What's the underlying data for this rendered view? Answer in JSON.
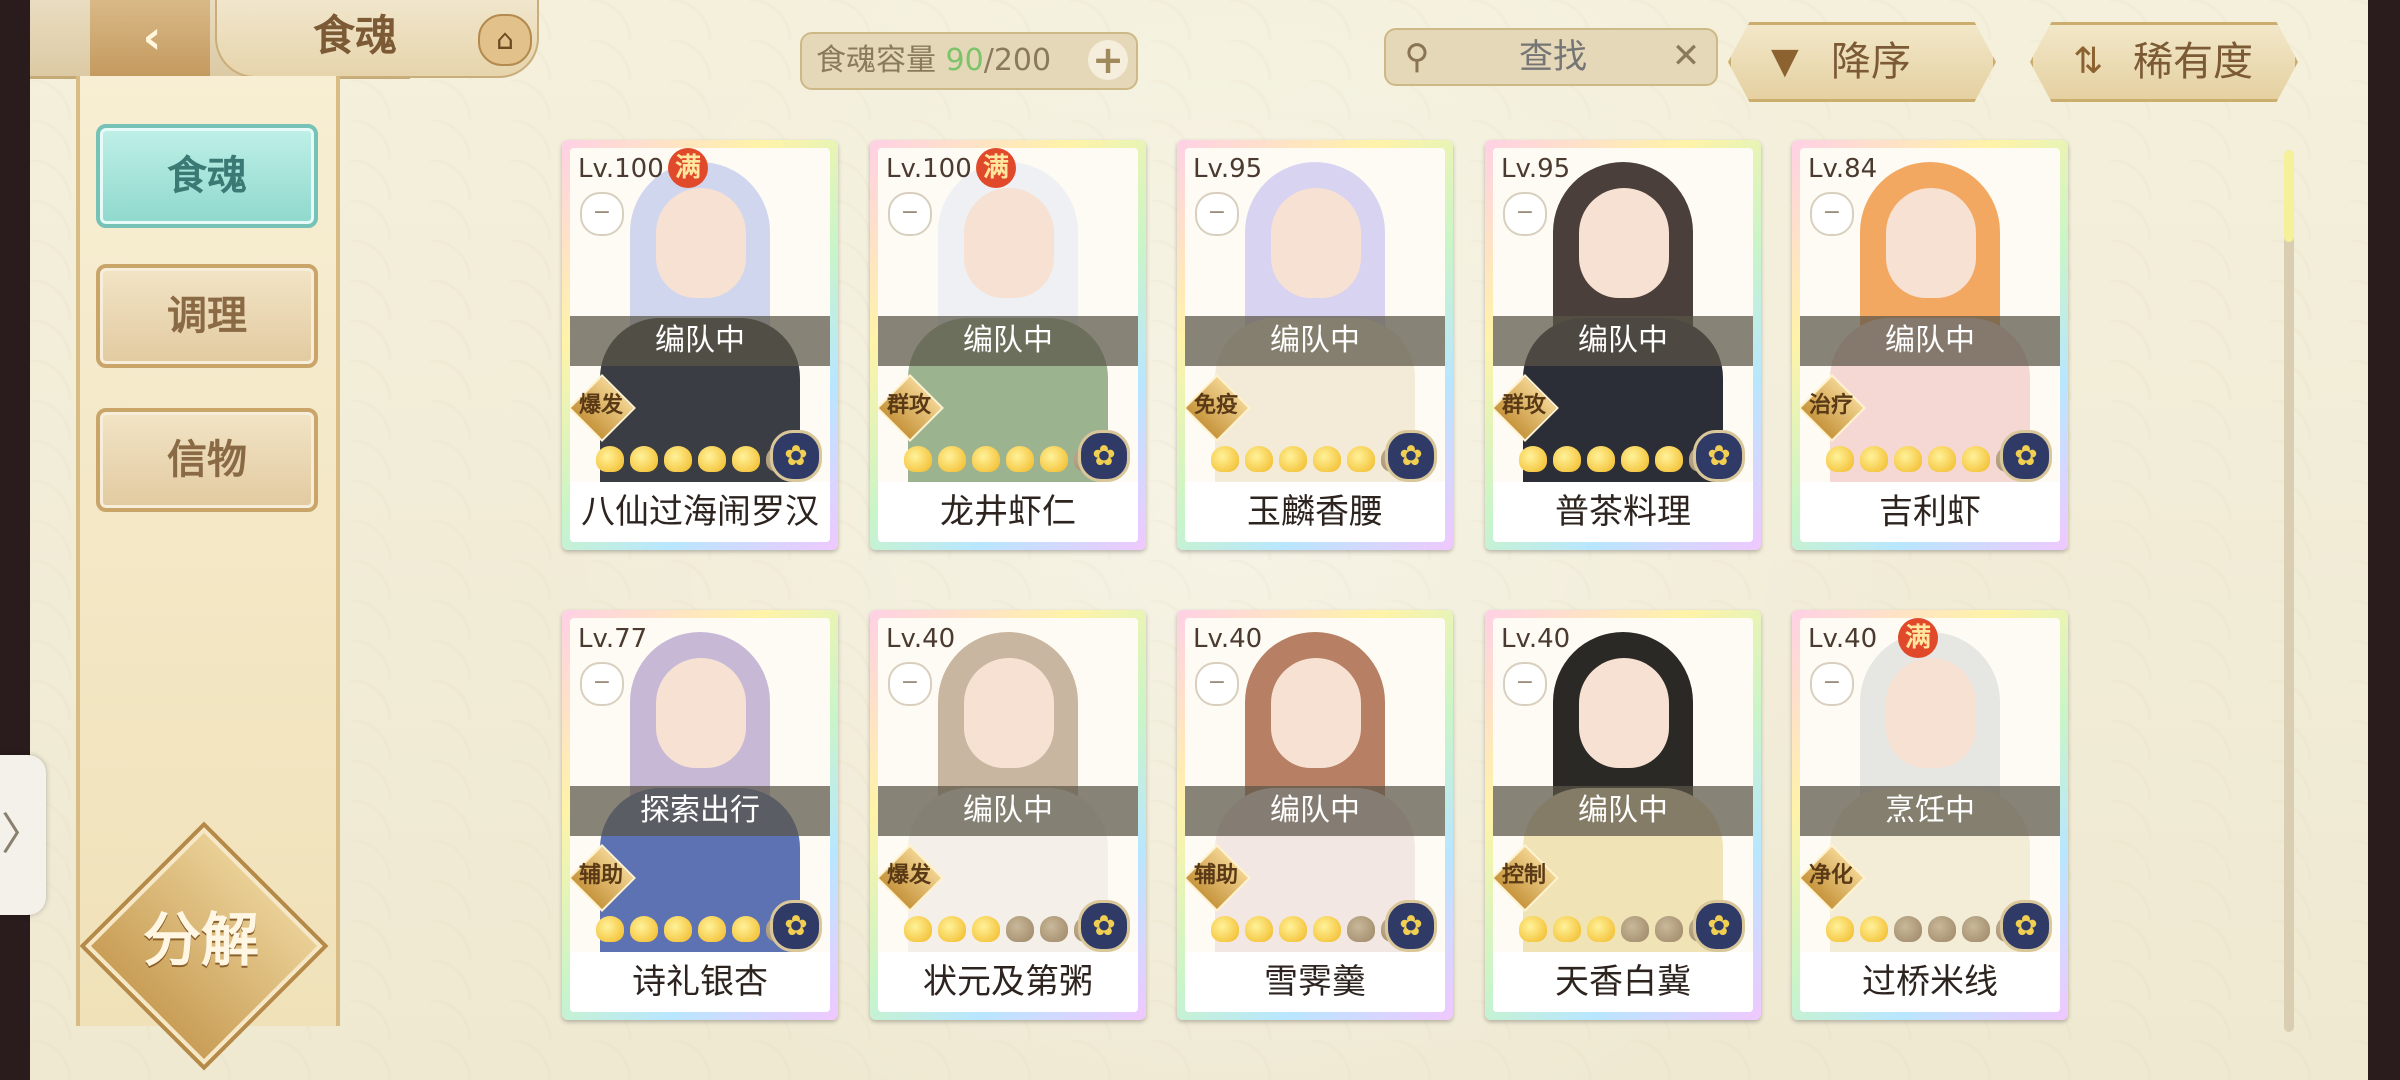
{
  "header": {
    "title": "食魂",
    "capacity_label": "食魂容量",
    "capacity_current": "90",
    "capacity_total": "/200",
    "search_placeholder": "查找",
    "sort_order_label": "降序",
    "sort_by_label": "稀有度"
  },
  "menu": {
    "items": [
      {
        "label": "食魂",
        "active": true
      },
      {
        "label": "调理",
        "active": false
      },
      {
        "label": "信物",
        "active": false
      }
    ],
    "decompose_label": "分解"
  },
  "cards": [
    {
      "level": "Lv.100",
      "full": "满",
      "status": "编队中",
      "role": "爆发",
      "stars_on": 5,
      "name": "八仙过海闹罗汉",
      "hair": "#cfd6ee",
      "body": "#3a3d44"
    },
    {
      "level": "Lv.100",
      "full": "满",
      "status": "编队中",
      "role": "群攻",
      "stars_on": 5,
      "name": "龙井虾仁",
      "hair": "#eef0f3",
      "body": "#9cb390"
    },
    {
      "level": "Lv.95",
      "full": "",
      "status": "编队中",
      "role": "免疫",
      "stars_on": 5,
      "name": "玉麟香腰",
      "hair": "#d9d3f2",
      "body": "#f3ebd8"
    },
    {
      "level": "Lv.95",
      "full": "",
      "status": "编队中",
      "role": "群攻",
      "stars_on": 5,
      "name": "普茶料理",
      "hair": "#4a3f3a",
      "body": "#2b2e36"
    },
    {
      "level": "Lv.84",
      "full": "",
      "status": "编队中",
      "role": "治疗",
      "stars_on": 5,
      "name": "吉利虾",
      "hair": "#f3a862",
      "body": "#f5d8d3"
    },
    {
      "level": "Lv.77",
      "full": "",
      "status": "探索出行",
      "role": "辅助",
      "stars_on": 5,
      "name": "诗礼银杏",
      "hair": "#c7b8d6",
      "body": "#5d72b3"
    },
    {
      "level": "Lv.40",
      "full": "",
      "status": "编队中",
      "role": "爆发",
      "stars_on": 3,
      "name": "状元及第粥",
      "hair": "#c9b6a0",
      "body": "#f4efe8"
    },
    {
      "level": "Lv.40",
      "full": "",
      "status": "编队中",
      "role": "辅助",
      "stars_on": 4,
      "name": "雪霁羹",
      "hair": "#b77f63",
      "body": "#f3e7e4"
    },
    {
      "level": "Lv.40",
      "full": "",
      "status": "编队中",
      "role": "控制",
      "stars_on": 3,
      "name": "天香白冀",
      "hair": "#2b2926",
      "body": "#f0e3b6"
    },
    {
      "level": "Lv.40",
      "full": "满",
      "status": "烹饪中",
      "role": "净化",
      "stars_on": 2,
      "name": "过桥米线",
      "hair": "#e6e6e2",
      "body": "#f3ecd7"
    }
  ],
  "icons": {
    "back": "back-arrow-icon",
    "home": "pavilion-icon",
    "plus": "plus-icon",
    "search": "search-icon",
    "clear": "close-icon",
    "sort_order": "down-triangle-icon",
    "sort_by": "sort-icon",
    "element": "flower-emblem-icon"
  }
}
